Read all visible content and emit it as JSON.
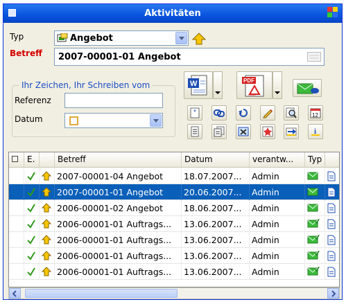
{
  "window": {
    "title": "Aktivitäten"
  },
  "form": {
    "typ_label": "Typ",
    "typ_value": "Angebot",
    "betreff_label": "Betreff",
    "betreff_value": "2007-00001-01 Angebot",
    "group_title": "Ihr Zeichen, Ihr Schreiben vom",
    "referenz_label": "Referenz",
    "referenz_value": "",
    "datum_label": "Datum",
    "datum_value": ""
  },
  "toolbar": {
    "big_buttons": [
      "word-document-icon",
      "pdf-adobe-icon",
      "email-send-icon"
    ],
    "small_buttons": [
      "new-sparkle-icon",
      "link-icon",
      "undo-icon",
      "edit-pencil-icon",
      "zoom-icon",
      "calendar-12-icon",
      "list-document-icon",
      "stack-document-icon",
      "grid-close-icon",
      "star-mark-icon",
      "arrow-right-icon",
      "underline-i-icon"
    ]
  },
  "grid": {
    "columns": [
      "",
      "E.",
      "",
      "Betreff",
      "Datum",
      "verantw...",
      "Typ",
      ""
    ],
    "rows": [
      {
        "betreff": "2007-00001-04 Angebot",
        "datum": "18.07.2007...",
        "verantw": "Admin",
        "typ": "mail",
        "selected": false
      },
      {
        "betreff": "2007-00001-01 Angebot",
        "datum": "20.06.2007...",
        "verantw": "Admin",
        "typ": "mail",
        "selected": true
      },
      {
        "betreff": "2006-00001-02 Angebot",
        "datum": "18.06.2007...",
        "verantw": "Admin",
        "typ": "mail",
        "selected": false
      },
      {
        "betreff": "2006-00001-01 Auftrags...",
        "datum": "13.06.2007...",
        "verantw": "Admin",
        "typ": "mail-check",
        "selected": false
      },
      {
        "betreff": "2006-00001-01 Auftrags...",
        "datum": "13.06.2007...",
        "verantw": "Admin",
        "typ": "mail-check",
        "selected": false
      },
      {
        "betreff": "2006-00001-01 Auftrags...",
        "datum": "13.06.2007...",
        "verantw": "Admin",
        "typ": "mail-check",
        "selected": false
      },
      {
        "betreff": "2006-00001-01 Auftrags...",
        "datum": "13.06.2007...",
        "verantw": "Admin",
        "typ": "mail-check",
        "selected": false
      }
    ]
  },
  "colors": {
    "title_bar": "#0a56e0",
    "selected_row": "#0a5fb8",
    "betreff_label": "#d40000",
    "group_title": "#1b4cc3",
    "check": "#2e9a1a",
    "arrow_up": "#f7c600"
  }
}
